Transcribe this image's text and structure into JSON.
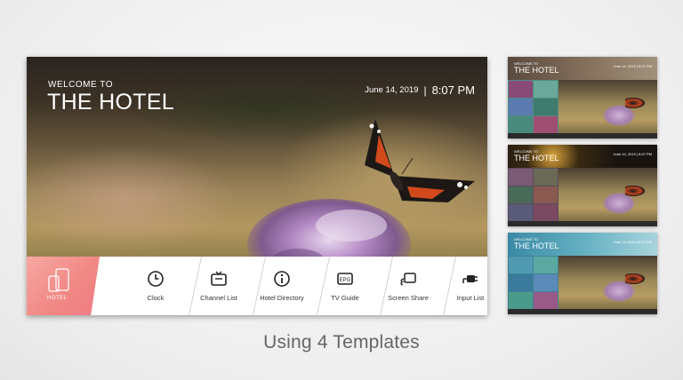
{
  "hero": {
    "welcome_line": "WELCOME TO",
    "title": "THE HOTEL",
    "date": "June 14, 2019",
    "separator": "|",
    "time": "8:07 PM"
  },
  "launcher": {
    "logo_text": "HOTEL",
    "apps": [
      {
        "label": "Clock",
        "icon": "clock-icon"
      },
      {
        "label": "Channel List",
        "icon": "tv-icon"
      },
      {
        "label": "Hotel Directory",
        "icon": "info-icon"
      },
      {
        "label": "TV Guide",
        "icon": "tv-guide-icon"
      },
      {
        "label": "Screen Share",
        "icon": "screen-share-icon"
      },
      {
        "label": "Input List",
        "icon": "input-plug-icon"
      }
    ]
  },
  "templates": [
    {
      "welcome": "WELCOME TO",
      "title": "THE HOTEL",
      "time": "June 14, 2019 | 8:07 PM",
      "accent": "#5b9a8e"
    },
    {
      "welcome": "WELCOME TO",
      "title": "THE HOTEL",
      "time": "June 14, 2019 | 8:07 PM",
      "accent": "#7a5a6e"
    },
    {
      "welcome": "WELCOME TO",
      "title": "THE HOTEL",
      "time": "June 14, 2019 | 8:07 PM",
      "accent": "#4b8fa6"
    }
  ],
  "caption": "Using 4 Templates",
  "colors": {
    "logo_tile": "#f18985",
    "launcher_bg": "#ffffff",
    "caption_text": "#666666"
  }
}
